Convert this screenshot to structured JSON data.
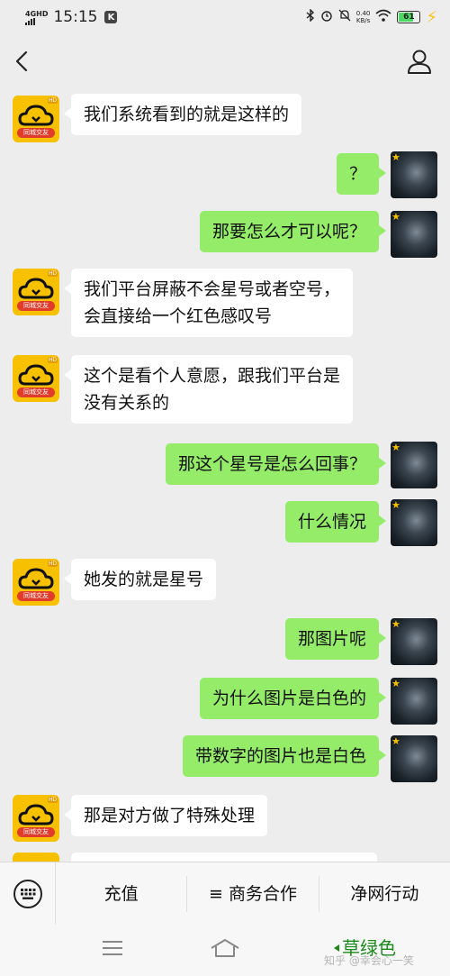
{
  "status_bar": {
    "network": "4GHD",
    "time": "15:15",
    "notif_app": "K",
    "speed_value": "0.40",
    "speed_unit": "KB/s",
    "battery": "61"
  },
  "header": {
    "back_icon": "chevron-left-icon",
    "profile_icon": "person-icon"
  },
  "app_avatar_tag": "同城交友",
  "app_avatar_hd": "HD",
  "messages": [
    {
      "side": "left",
      "text": "我们系统看到的就是这样的"
    },
    {
      "side": "right",
      "text": "？"
    },
    {
      "side": "right",
      "text": "那要怎么才可以呢？"
    },
    {
      "side": "left",
      "text": "我们平台屏蔽不会星号或者空号，\n会直接给一个红色感叹号"
    },
    {
      "side": "left",
      "text": "这个是看个人意愿，跟我们平台是\n没有关系的"
    },
    {
      "side": "right",
      "text": "那这个星号是怎么回事？"
    },
    {
      "side": "right",
      "text": "什么情况"
    },
    {
      "side": "left",
      "text": "她发的就是星号"
    },
    {
      "side": "right",
      "text": "那图片呢"
    },
    {
      "side": "right",
      "text": "为什么图片是白色的"
    },
    {
      "side": "right",
      "text": "带数字的图片也是白色"
    },
    {
      "side": "left",
      "text": "那是对方做了特殊处理"
    }
  ],
  "bottom_menu": {
    "keyboard_icon": "keyboard-icon",
    "items": [
      "充值",
      "≡ 商务合作",
      "净网行动"
    ]
  },
  "nav_bar": {
    "menu_icon": "menu-icon",
    "home_icon": "home-icon"
  },
  "watermark": {
    "caption": "草绿色",
    "source": "知乎 @幸会心一笑"
  },
  "colors": {
    "chat_bg": "#ededed",
    "sent_bubble": "#95ec69",
    "received_bubble": "#ffffff",
    "app_avatar": "#f7c000"
  }
}
